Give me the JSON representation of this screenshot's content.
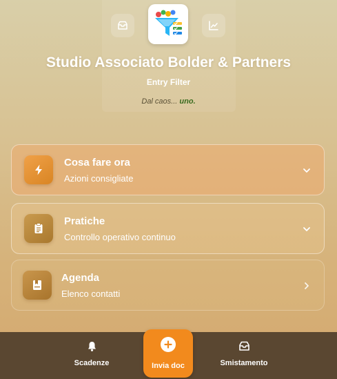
{
  "header": {
    "org_title": "Studio Associato Bolder & Partners",
    "app_subtitle": "Entry Filter",
    "tagline_prefix": "Dal caos...",
    "tagline_accent": "uno.",
    "left_icon": "inbox-icon",
    "right_icon": "chart-icon",
    "logo_icon": "funnel-logo-icon"
  },
  "cards": [
    {
      "title": "Cosa fare ora",
      "subtitle": "Azioni consigliate",
      "icon": "lightning-icon",
      "chevron": "chevron-down-icon"
    },
    {
      "title": "Pratiche",
      "subtitle": "Controllo operativo continuo",
      "icon": "clipboard-icon",
      "chevron": "chevron-down-icon"
    },
    {
      "title": "Agenda",
      "subtitle": "Elenco contatti",
      "icon": "address-book-icon",
      "chevron": "chevron-right-icon"
    }
  ],
  "bottom_nav": {
    "left": {
      "label": "Scadenze",
      "icon": "bell-icon"
    },
    "primary": {
      "label": "Invia doc",
      "icon": "plus-icon"
    },
    "right": {
      "label": "Smistamento",
      "icon": "inbox-tray-icon"
    }
  },
  "colors": {
    "accent_orange": "#f28a1d",
    "nav_bg": "#5a4731",
    "tagline_green": "#3a6b1f"
  }
}
